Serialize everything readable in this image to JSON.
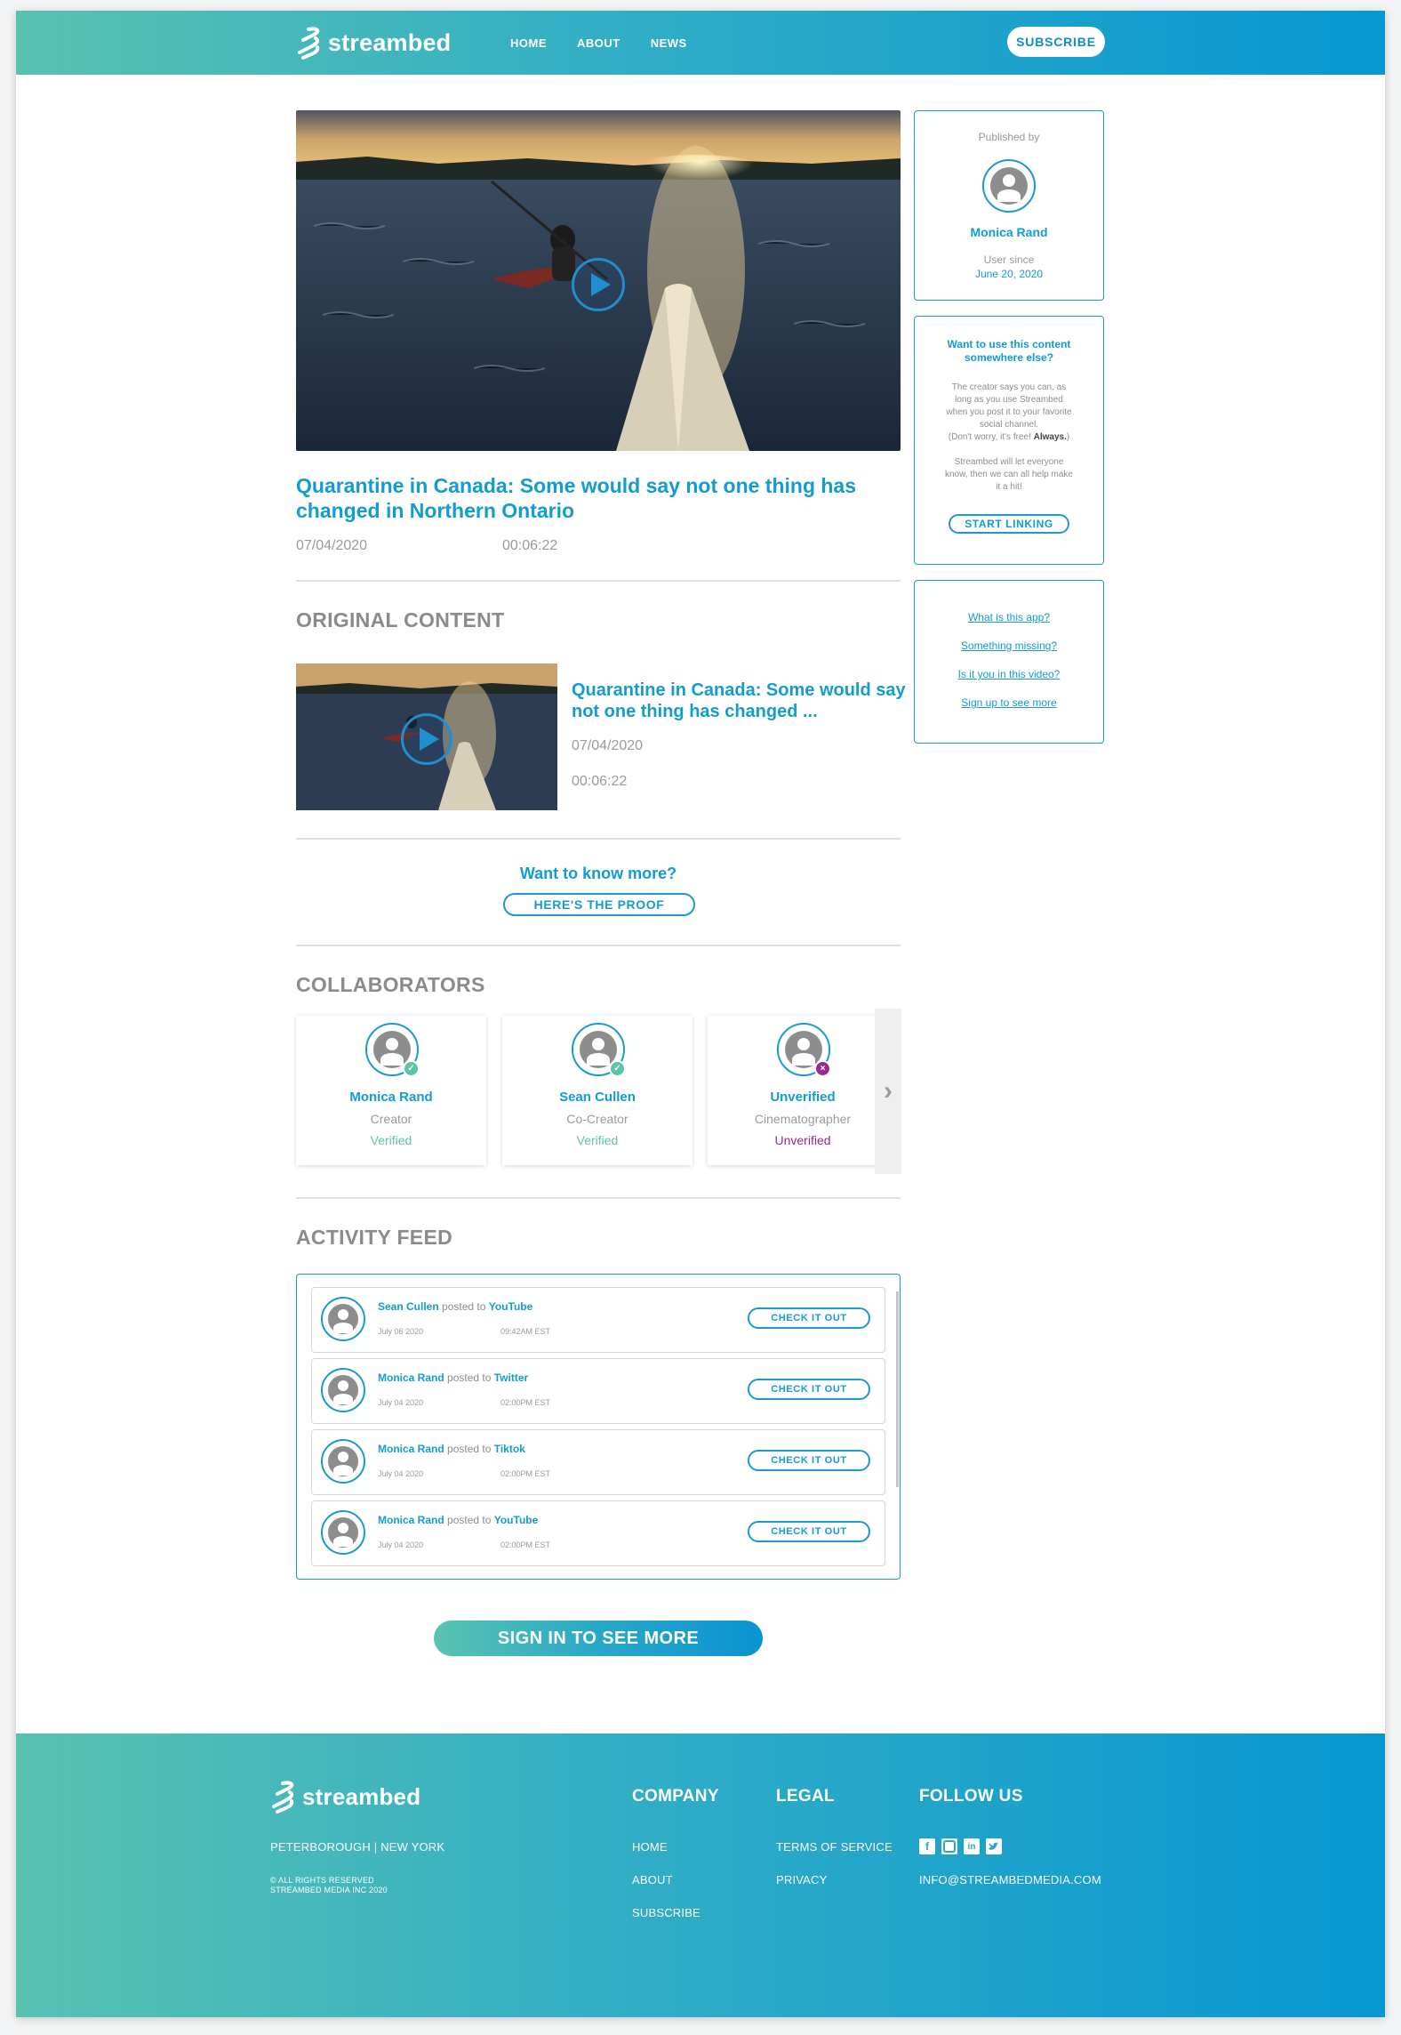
{
  "header": {
    "logo_text": "streambed",
    "nav": [
      "HOME",
      "ABOUT",
      "NEWS"
    ],
    "subscribe": "SUBSCRIBE"
  },
  "video": {
    "title": "Quarantine in Canada: Some would say not one thing has changed in Northern Ontario",
    "date": "07/04/2020",
    "duration": "00:06:22"
  },
  "original": {
    "heading": "ORIGINAL CONTENT",
    "title": "Quarantine in Canada: Some would say not one thing has changed ...",
    "date": "07/04/2020",
    "duration": "00:06:22"
  },
  "proof": {
    "question": "Want to know more?",
    "button": "HERE'S THE PROOF"
  },
  "collaborators": {
    "heading": "COLLABORATORS",
    "items": [
      {
        "name": "Monica Rand",
        "role": "Creator",
        "status": "Verified"
      },
      {
        "name": "Sean Cullen",
        "role": "Co-Creator",
        "status": "Verified"
      },
      {
        "name": "Unverified",
        "role": "Cinematographer",
        "status": "Unverified"
      }
    ],
    "verified_color": "#5cc3a6",
    "unverified_color": "#9a2b8e"
  },
  "activity": {
    "heading": "ACTIVITY FEED",
    "posted_word": "posted to",
    "button": "CHECK IT OUT",
    "items": [
      {
        "user": "Sean Cullen",
        "platform": "YouTube",
        "date": "July 06 2020",
        "time": "09:42AM EST"
      },
      {
        "user": "Monica Rand",
        "platform": "Twitter",
        "date": "July 04 2020",
        "time": "02:00PM EST"
      },
      {
        "user": "Monica Rand",
        "platform": "Tiktok",
        "date": "July 04 2020",
        "time": "02:00PM EST"
      },
      {
        "user": "Monica Rand",
        "platform": "YouTube",
        "date": "July 04 2020",
        "time": "02:00PM EST"
      }
    ]
  },
  "sign_in": "SIGN IN TO SEE MORE",
  "sidebar": {
    "published_by": "Published by",
    "author": "Monica Rand",
    "user_since_label": "User since",
    "user_since": "June 20, 2020",
    "use_title_1": "Want to use this content",
    "use_title_2": "somewhere else?",
    "use_body_1": "The creator says you can, as",
    "use_body_2": "long as you use Streambed",
    "use_body_3": "when you post it to your favorite",
    "use_body_4": "social channel.",
    "use_body_5": "(Don't worry, it's free!",
    "use_body_5b": "Always.",
    "use_body_6": "Streambed will let everyone",
    "use_body_7": "know, then we can all help make",
    "use_body_8": "it a hit!",
    "start_linking": "START LINKING",
    "links": [
      "What is this app?",
      "Something missing?",
      "Is it you in this video?",
      "Sign up to see more"
    ]
  },
  "footer": {
    "logo_text": "streambed",
    "location": "PETERBOROUGH | NEW YORK",
    "rights_1": "© ALL RIGHTS RESERVED",
    "rights_2": "STREAMBED MEDIA INC 2020",
    "company_heading": "COMPANY",
    "company_links": [
      "HOME",
      "ABOUT",
      "SUBSCRIBE"
    ],
    "legal_heading": "LEGAL",
    "legal_links": [
      "TERMS OF SERVICE",
      "PRIVACY"
    ],
    "follow_heading": "FOLLOW US",
    "social_icons": [
      "facebook-icon",
      "instagram-icon",
      "linkedin-icon",
      "twitter-icon"
    ],
    "email": "INFO@STREAMBEDMEDIA.COM"
  },
  "colors": {
    "accent": "#129ccf",
    "gradient_start": "#58c2b1",
    "gradient_end": "#0797d1"
  }
}
